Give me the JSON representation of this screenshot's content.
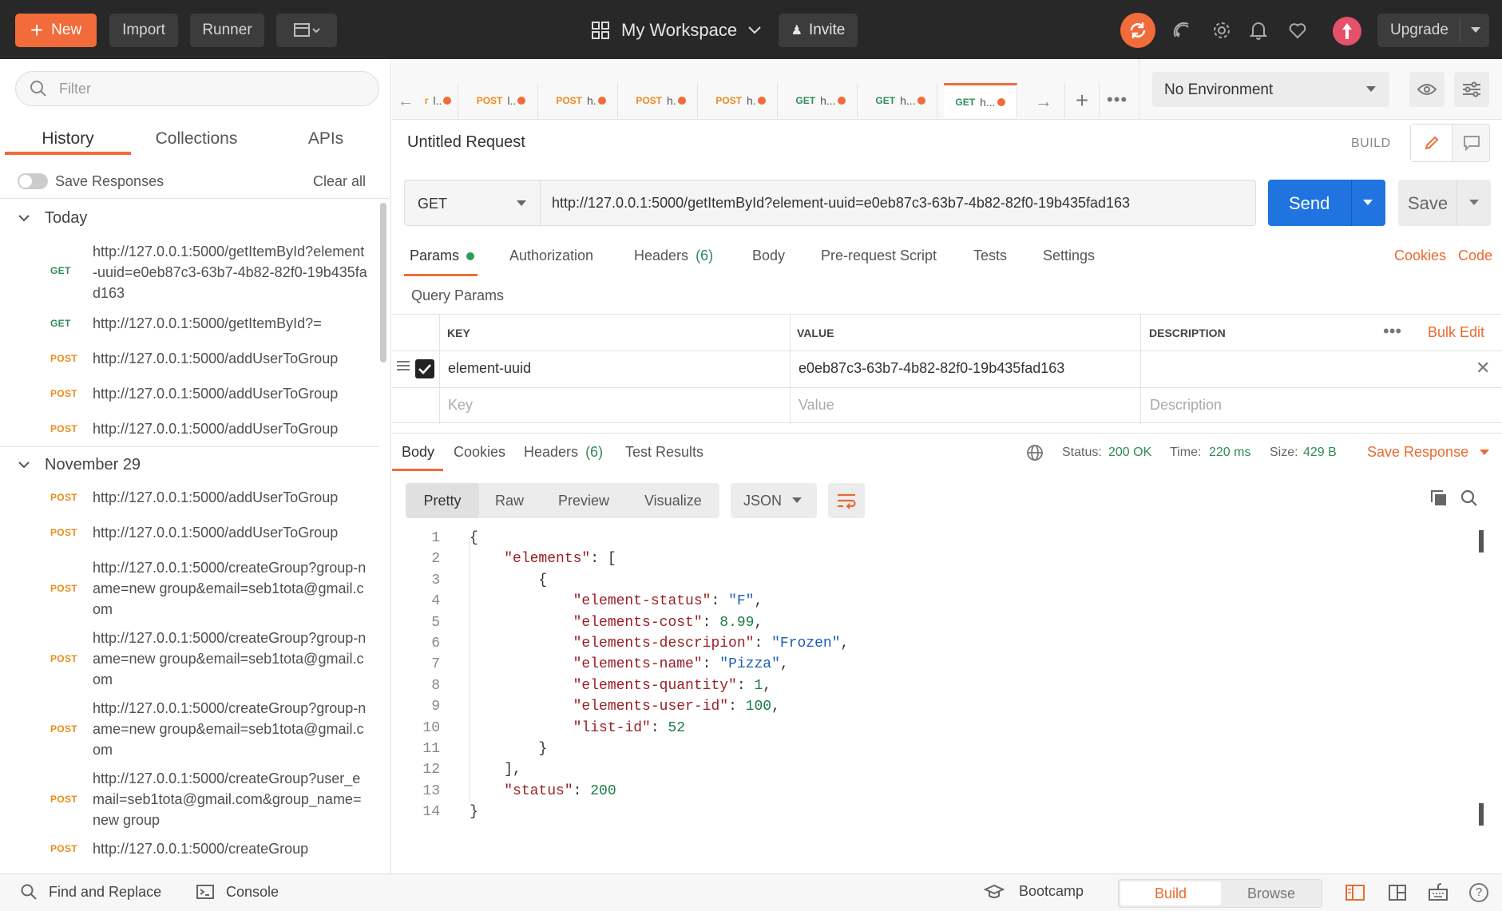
{
  "topbar": {
    "new_label": "New",
    "import_label": "Import",
    "runner_label": "Runner",
    "workspace_label": "My Workspace",
    "invite_label": "Invite",
    "upgrade_label": "Upgrade"
  },
  "sidebar": {
    "filter_placeholder": "Filter",
    "tabs": [
      "History",
      "Collections",
      "APIs"
    ],
    "save_responses_label": "Save Responses",
    "clear_all_label": "Clear all",
    "groups": [
      {
        "title": "Today",
        "items": [
          {
            "method": "GET",
            "url": "http://127.0.0.1:5000/getItemById?element-uuid=e0eb87c3-63b7-4b82-82f0-19b435fad163"
          },
          {
            "method": "GET",
            "url": "http://127.0.0.1:5000/getItemById?="
          },
          {
            "method": "POST",
            "url": "http://127.0.0.1:5000/addUserToGroup"
          },
          {
            "method": "POST",
            "url": "http://127.0.0.1:5000/addUserToGroup"
          },
          {
            "method": "POST",
            "url": "http://127.0.0.1:5000/addUserToGroup"
          }
        ]
      },
      {
        "title": "November 29",
        "items": [
          {
            "method": "POST",
            "url": "http://127.0.0.1:5000/addUserToGroup"
          },
          {
            "method": "POST",
            "url": "http://127.0.0.1:5000/addUserToGroup"
          },
          {
            "method": "POST",
            "url": "http://127.0.0.1:5000/createGroup?group-name=new group&email=seb1tota@gmail.com"
          },
          {
            "method": "POST",
            "url": "http://127.0.0.1:5000/createGroup?group-name=new group&email=seb1tota@gmail.com"
          },
          {
            "method": "POST",
            "url": "http://127.0.0.1:5000/createGroup?group-name=new group&email=seb1tota@gmail.com"
          },
          {
            "method": "POST",
            "url": "http://127.0.0.1:5000/createGroup?user_email=seb1tota@gmail.com&group_name=new group"
          },
          {
            "method": "POST",
            "url": "http://127.0.0.1:5000/createGroup"
          }
        ]
      }
    ]
  },
  "tabs_bar": {
    "tabs": [
      {
        "method": "r",
        "label": "l.."
      },
      {
        "method": "POST",
        "label": "l.."
      },
      {
        "method": "POST",
        "label": "h."
      },
      {
        "method": "POST",
        "label": "h."
      },
      {
        "method": "POST",
        "label": "h."
      },
      {
        "method": "GET",
        "label": "h..."
      },
      {
        "method": "GET",
        "label": "h..."
      },
      {
        "method": "GET",
        "label": "h..."
      }
    ],
    "environment_label": "No Environment"
  },
  "request": {
    "title": "Untitled Request",
    "build_label": "BUILD",
    "method": "GET",
    "url": "http://127.0.0.1:5000/getItemById?element-uuid=e0eb87c3-63b7-4b82-82f0-19b435fad163",
    "send_label": "Send",
    "save_label": "Save",
    "subtabs": [
      "Params",
      "Authorization",
      "Headers",
      "Body",
      "Pre-request Script",
      "Tests",
      "Settings"
    ],
    "headers_count": "(6)",
    "cookies_label": "Cookies",
    "code_label": "Code",
    "query_params_label": "Query Params",
    "table_headers": [
      "KEY",
      "VALUE",
      "DESCRIPTION"
    ],
    "bulk_edit_label": "Bulk Edit",
    "param_key": "element-uuid",
    "param_value": "e0eb87c3-63b7-4b82-82f0-19b435fad163",
    "key_placeholder": "Key",
    "value_placeholder": "Value",
    "description_placeholder": "Description"
  },
  "response": {
    "tabs": [
      "Body",
      "Cookies",
      "Headers",
      "Test Results"
    ],
    "headers_count": "(6)",
    "status_label": "Status:",
    "status_value": "200 OK",
    "time_label": "Time:",
    "time_value": "220 ms",
    "size_label": "Size:",
    "size_value": "429 B",
    "save_response_label": "Save Response",
    "view_tabs": [
      "Pretty",
      "Raw",
      "Preview",
      "Visualize"
    ],
    "format": "JSON",
    "code_lines": [
      "{",
      "    \"elements\": [",
      "        {",
      "            \"element-status\": \"F\",",
      "            \"elements-cost\": 8.99,",
      "            \"elements-descripion\": \"Frozen\",",
      "            \"elements-name\": \"Pizza\",",
      "            \"elements-quantity\": 1,",
      "            \"elements-user-id\": 100,",
      "            \"list-id\": 52",
      "        }",
      "    ],",
      "    \"status\": 200",
      "}"
    ]
  },
  "bottombar": {
    "find_replace_label": "Find and Replace",
    "console_label": "Console",
    "bootcamp_label": "Bootcamp",
    "build_label": "Build",
    "browse_label": "Browse"
  }
}
